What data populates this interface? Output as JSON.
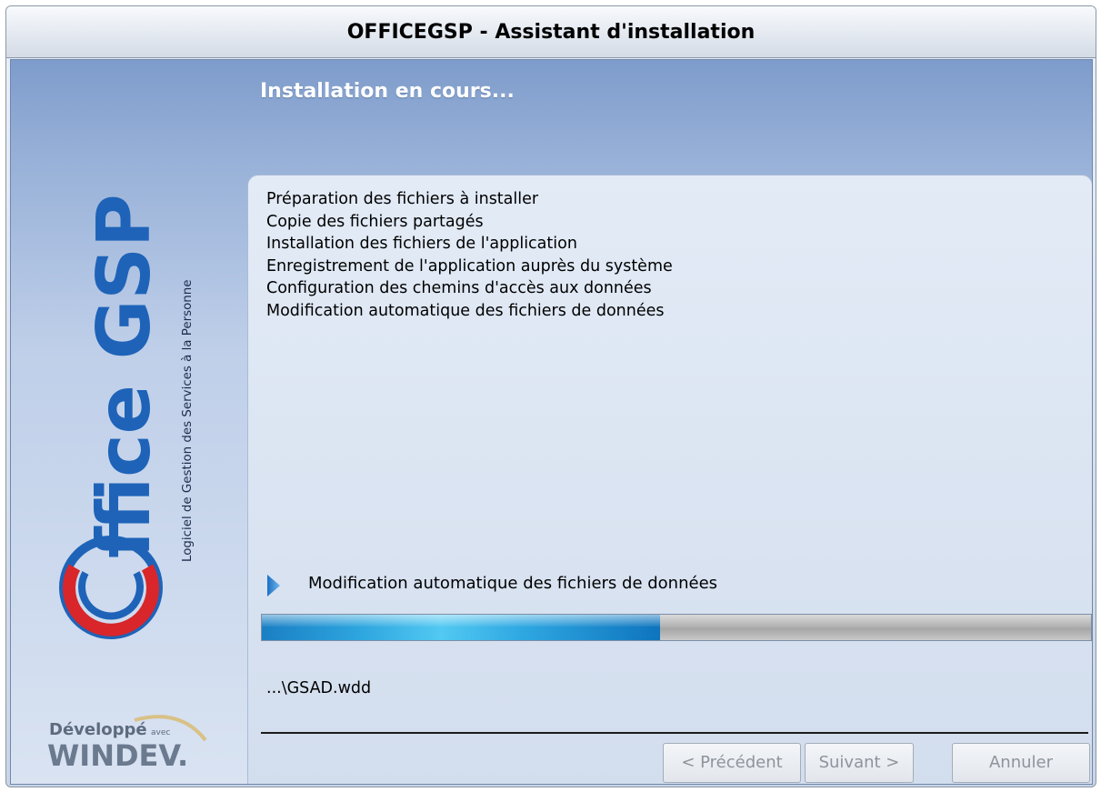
{
  "window": {
    "title": "OFFICEGSP - Assistant d'installation"
  },
  "header": {
    "title": "Installation en cours..."
  },
  "branding": {
    "logo_text": "ffice GSP",
    "logo_subtitle": "Logiciel de Gestion des Services à la Personne",
    "footer_logo_line1": "Développé",
    "footer_logo_small": "avec",
    "footer_logo_line2": "WINDEV."
  },
  "steps": [
    "Préparation des fichiers à installer",
    "Copie des fichiers partagés",
    "Installation des fichiers de l'application",
    "Enregistrement de l'application auprès du système",
    "Configuration des chemins d'accès aux données",
    "Modification automatique des fichiers de données"
  ],
  "current_step": {
    "icon": "arrow-right-icon",
    "label": "Modification automatique des fichiers de données"
  },
  "progress": {
    "fraction": 0.48
  },
  "current_file": "...\\GSAD.wdd",
  "buttons": {
    "previous": "< Précédent",
    "next": "Suivant >",
    "cancel": "Annuler",
    "previous_enabled": false,
    "next_enabled": false,
    "cancel_enabled": false
  },
  "colors": {
    "header_blue": "#7e9ccb",
    "progress_fill": "#2ea6df",
    "logo_red": "#d8262b",
    "logo_blue": "#1e63b8"
  }
}
